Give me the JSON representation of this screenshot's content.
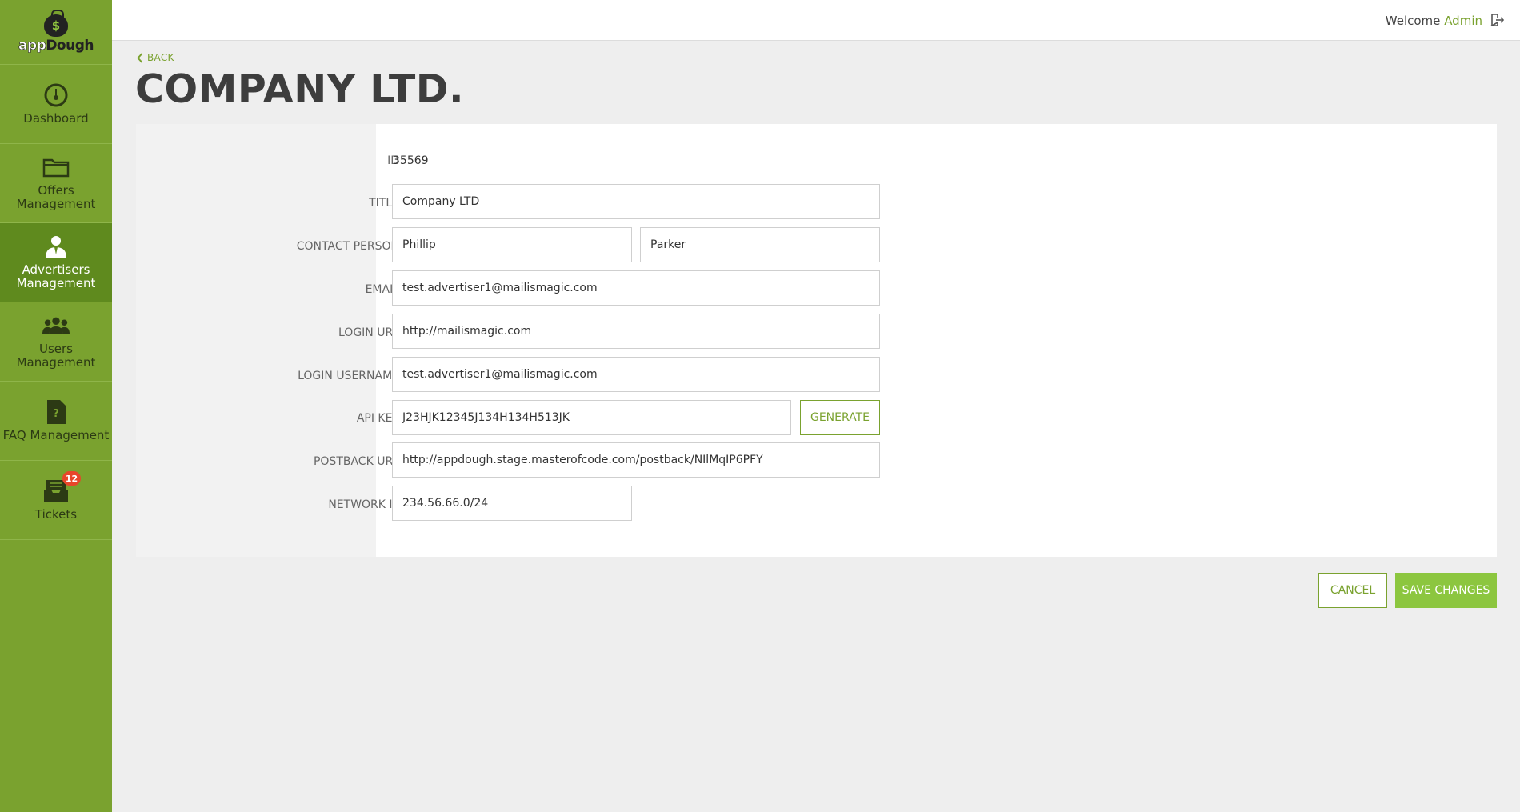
{
  "brand": {
    "logo_prefix": "app",
    "logo_suffix": "Dough",
    "logo_symbol": "$"
  },
  "sidebar": {
    "items": [
      {
        "label": "Dashboard",
        "icon": "speedometer-icon",
        "active": false
      },
      {
        "label": "Offers Management",
        "icon": "folder-icon",
        "active": false
      },
      {
        "label": "Advertisers Management",
        "icon": "advertiser-icon",
        "active": true
      },
      {
        "label": "Users Management",
        "icon": "users-group-icon",
        "active": false
      },
      {
        "label": "FAQ Management",
        "icon": "faq-document-icon",
        "active": false
      },
      {
        "label": "Tickets",
        "icon": "inbox-tray-icon",
        "active": false,
        "badge": "12"
      }
    ]
  },
  "header": {
    "welcome": "Welcome",
    "user": "Admin",
    "logout_icon": "logout-icon"
  },
  "page": {
    "back_label": "BACK",
    "title": "COMPANY LTD."
  },
  "form": {
    "id_label": "ID",
    "id_value": "35569",
    "title_label": "TITLE",
    "title_value": "Company LTD",
    "contact_label": "CONTACT PERSON",
    "contact_first": "Phillip",
    "contact_last": "Parker",
    "email_label": "EMAIL",
    "email_value": "test.advertiser1@mailismagic.com",
    "login_url_label": "LOGIN URL",
    "login_url_value": "http://mailismagic.com",
    "login_username_label": "LOGIN USERNAME",
    "login_username_value": "test.advertiser1@mailismagic.com",
    "api_key_label": "API KEY",
    "api_key_value": "J23HJK12345J134H134H513JK",
    "generate_label": "GENERATE",
    "postback_label": "POSTBACK URL",
    "postback_value": "http://appdough.stage.masterofcode.com/postback/NIlMqIP6PFY",
    "network_ip_label": "NETWORK IP",
    "network_ip_value": "234.56.66.0/24"
  },
  "actions": {
    "cancel_label": "CANCEL",
    "save_label": "SAVE CHANGES"
  },
  "colors": {
    "accent": "#7aa22f",
    "sidebar": "#7aa22f",
    "sidebar_active": "#5f8a1e",
    "button": "#8cc63f",
    "badge": "#e8462a"
  }
}
